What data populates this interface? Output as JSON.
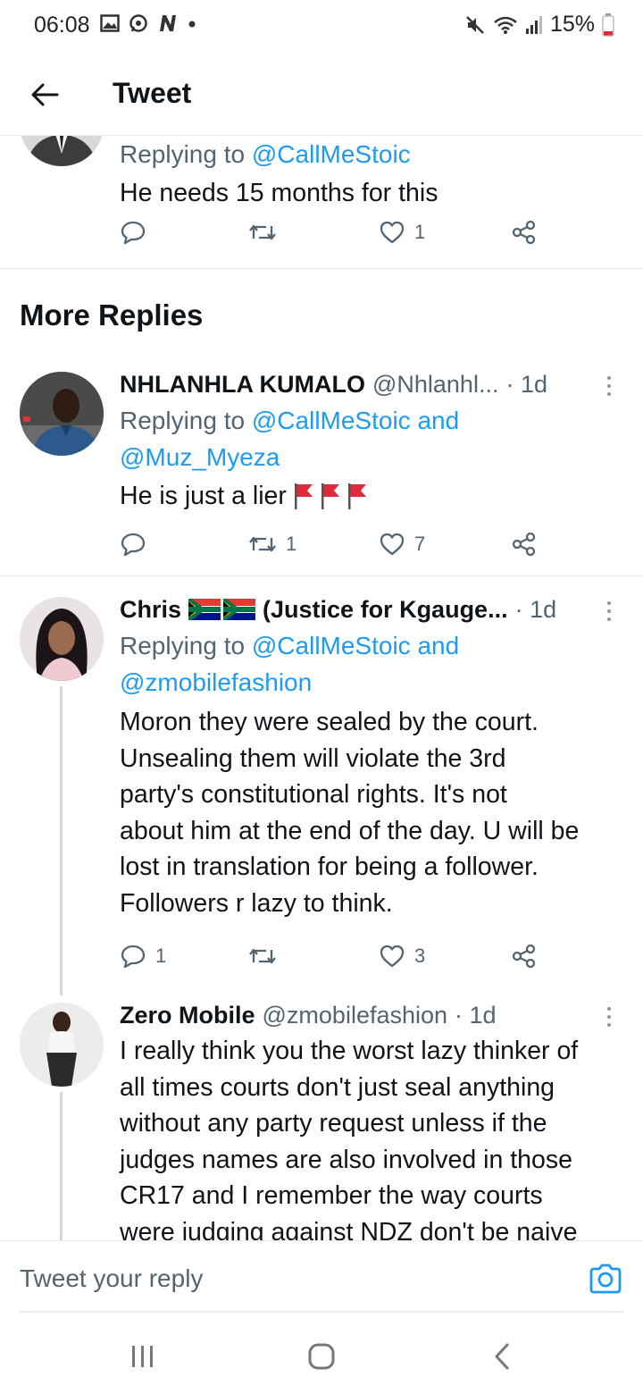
{
  "status_bar": {
    "time": "06:08",
    "battery": "15%",
    "left_icons": [
      "gallery-icon",
      "whatsapp-icon",
      "n-icon",
      "dot-icon"
    ],
    "right_icons": [
      "mute-icon",
      "wifi-icon",
      "signal-icon",
      "battery-icon"
    ]
  },
  "header": {
    "title": "Tweet"
  },
  "top_tweet": {
    "replying_prefix": "Replying to",
    "mentions": "@CallMeStoic",
    "text": "He needs 15 months for this",
    "likes": "1"
  },
  "section": {
    "title": "More Replies"
  },
  "replies": [
    {
      "name": "NHLANHLA KUMALO",
      "handle": "@Nhlanhl...",
      "time": "· 1d",
      "replying_prefix": "Replying to",
      "mention_line1": "@CallMeStoic and",
      "mention_line2": "@Muz_Myeza",
      "text": "He is just a lier",
      "retweets": "1",
      "likes": "7"
    },
    {
      "name_part1": "Chris",
      "name_part2": "(Justice for Kgauge...",
      "time": "· 1d",
      "replying_prefix": "Replying to",
      "mention_line1": "@CallMeStoic and",
      "mention_line2": "@zmobilefashion",
      "text_lines": [
        "Moron they were sealed by the court.",
        "Unsealing them will violate the 3rd",
        "party's constitutional rights. It's not",
        "about him at the end of the day. U will be",
        "lost in translation for being a follower.",
        "Followers r lazy to think."
      ],
      "replies": "1",
      "likes": "3"
    },
    {
      "name": "Zero Mobile",
      "handle": "@zmobilefashion",
      "time": "· 1d",
      "text_lines": [
        "I really think you the worst lazy thinker of",
        "all times courts don't just seal anything",
        "without any party request unless if the",
        "judges names are also involved in those",
        "CR17 and I remember the way courts",
        "were judging against NDZ don't be naive"
      ]
    }
  ],
  "reply_bar": {
    "placeholder": "Tweet your reply"
  },
  "colors": {
    "accent": "#1d9bf0",
    "text_secondary": "#536471",
    "divider": "#e6ecf0",
    "red_flag": "#e0293b"
  }
}
